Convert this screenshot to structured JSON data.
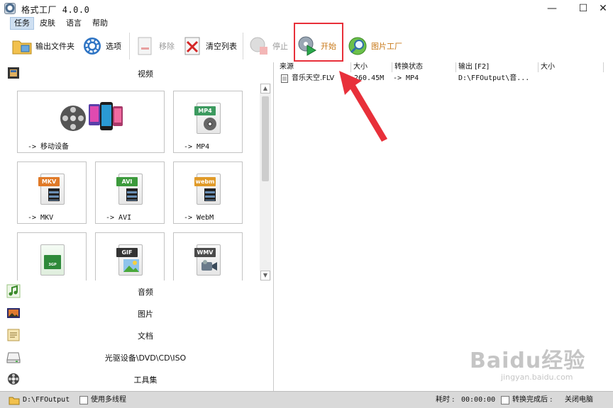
{
  "window": {
    "title": "格式工厂 4.0.0",
    "controls": {
      "minimize": "—",
      "maximize": "☐",
      "close": "✕"
    }
  },
  "menu": [
    "任务",
    "皮肤",
    "语言",
    "帮助"
  ],
  "toolbar": {
    "output_folder": "输出文件夹",
    "options": "选项",
    "remove": "移除",
    "clear_list": "清空列表",
    "stop": "停止",
    "start": "开始",
    "picture_factory": "图片工厂"
  },
  "categories": {
    "video": "视频",
    "audio": "音频",
    "picture": "图片",
    "document": "文档",
    "disc": "光驱设备\\DVD\\CD\\ISO",
    "toolbox": "工具集"
  },
  "video_tiles": [
    {
      "label": "-> 移动设备"
    },
    {
      "label": "-> MP4",
      "tag": "MP4",
      "color": "#3c9a5f"
    },
    {
      "label": "-> MKV",
      "tag": "MKV",
      "color": "#e07a28"
    },
    {
      "label": "-> AVI",
      "tag": "AVI",
      "color": "#3c9a3c"
    },
    {
      "label": "-> WebM",
      "tag": "webm",
      "color": "#e09a28"
    },
    {
      "label": "",
      "tag": "3GP",
      "color": "#2e8a3a"
    },
    {
      "label": "",
      "tag": "GIF",
      "color": "#333333"
    },
    {
      "label": "",
      "tag": "WMV",
      "color": "#4a4a4a"
    }
  ],
  "list": {
    "headers": [
      "来源",
      "大小",
      "转换状态",
      "输出 [F2]",
      "大小"
    ],
    "rows": [
      {
        "source": "音乐天空.FLV",
        "size": "260.45M",
        "status": "-> MP4",
        "output": "D:\\FFOutput\\音...",
        "out_size": ""
      }
    ]
  },
  "status": {
    "output_path": "D:\\FFOutput",
    "multithread": "使用多线程",
    "elapsed_label": "耗时 :",
    "elapsed_value": "00:00:00",
    "after_convert": "转换完成后 :",
    "after_action": "关闭电脑"
  },
  "colors": {
    "highlight": "#e8303a",
    "menu_active": "#cfe0f2"
  },
  "watermark": {
    "brand": "Baidu经验",
    "url": "jingyan.baidu.com"
  }
}
